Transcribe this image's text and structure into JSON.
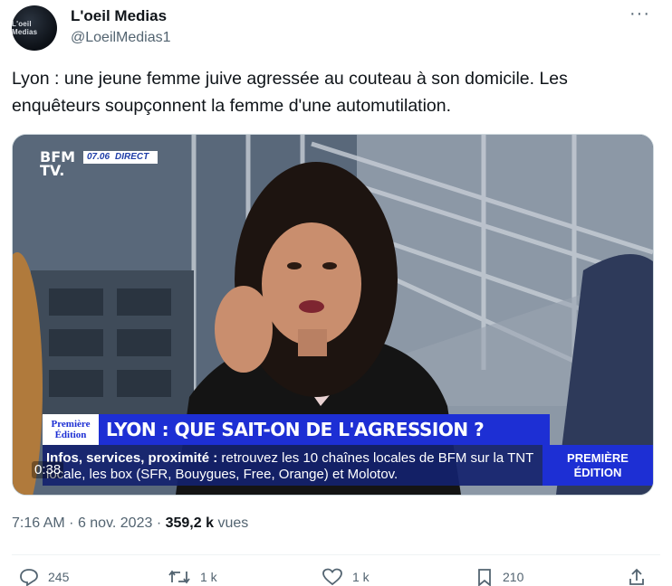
{
  "author": {
    "name": "L'oeil Medias",
    "handle": "@LoeilMedias1",
    "avatar_text": "L'oeil Medias"
  },
  "more_icon": "more-horizontal-icon",
  "tweet": {
    "text": "Lyon : une jeune femme juive agressée au couteau à son domicile. Les enquêteurs soupçonnent la femme d'une automutilation."
  },
  "media": {
    "channel_logo": "BFM TV.",
    "live_time": "07.06",
    "live_label": "DIRECT",
    "edition_badge": "Première Édition",
    "headline": "LYON : QUE SAIT-ON DE L'AGRESSION ?",
    "ticker_bold": "Infos, services, proximité :",
    "ticker_text": "retrouvez les 10 chaînes locales de BFM sur la TNT locale, les box (SFR, Bouygues, Free, Orange) et Molotov.",
    "edition_box": "PREMIÈRE ÉDITION",
    "video_time": "0:38"
  },
  "meta": {
    "time": "7:16 AM",
    "separator": "·",
    "date": "6 nov. 2023",
    "views_count": "359,2 k",
    "views_label": "vues"
  },
  "actions": [
    {
      "icon": "reply-icon",
      "count": "245"
    },
    {
      "icon": "retweet-icon",
      "count": "1 k"
    },
    {
      "icon": "like-icon",
      "count": "1 k"
    },
    {
      "icon": "bookmark-icon",
      "count": "210"
    },
    {
      "icon": "share-icon",
      "count": ""
    }
  ]
}
